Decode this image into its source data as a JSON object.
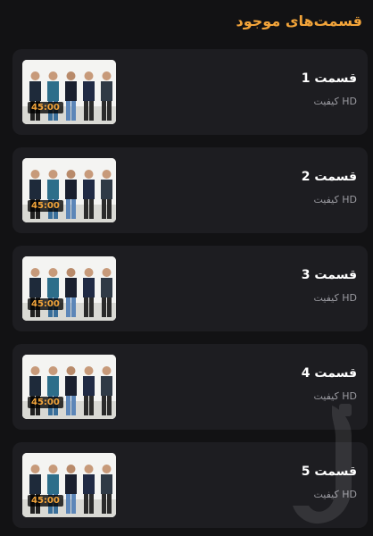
{
  "header": {
    "title": "قسمت‌های موجود"
  },
  "episodes": [
    {
      "title": "قسمت 1",
      "quality": "HD کیفیت",
      "duration": "45:00",
      "thumbnail_icon": "group-photo-thumbnail"
    },
    {
      "title": "قسمت 2",
      "quality": "HD کیفیت",
      "duration": "45:00",
      "thumbnail_icon": "group-photo-thumbnail"
    },
    {
      "title": "قسمت 3",
      "quality": "HD کیفیت",
      "duration": "45:00",
      "thumbnail_icon": "group-photo-thumbnail"
    },
    {
      "title": "قسمت 4",
      "quality": "HD کیفیت",
      "duration": "45:00",
      "thumbnail_icon": "group-photo-thumbnail"
    },
    {
      "title": "قسمت 5",
      "quality": "HD کیفیت",
      "duration": "45:00",
      "thumbnail_icon": "group-photo-thumbnail"
    }
  ],
  "colors": {
    "background": "#121214",
    "card": "#1d1d21",
    "accent": "#f2a43a",
    "text": "#ffffff",
    "muted": "#9a9aa0"
  },
  "watermark_icon": "store-logo-watermark"
}
